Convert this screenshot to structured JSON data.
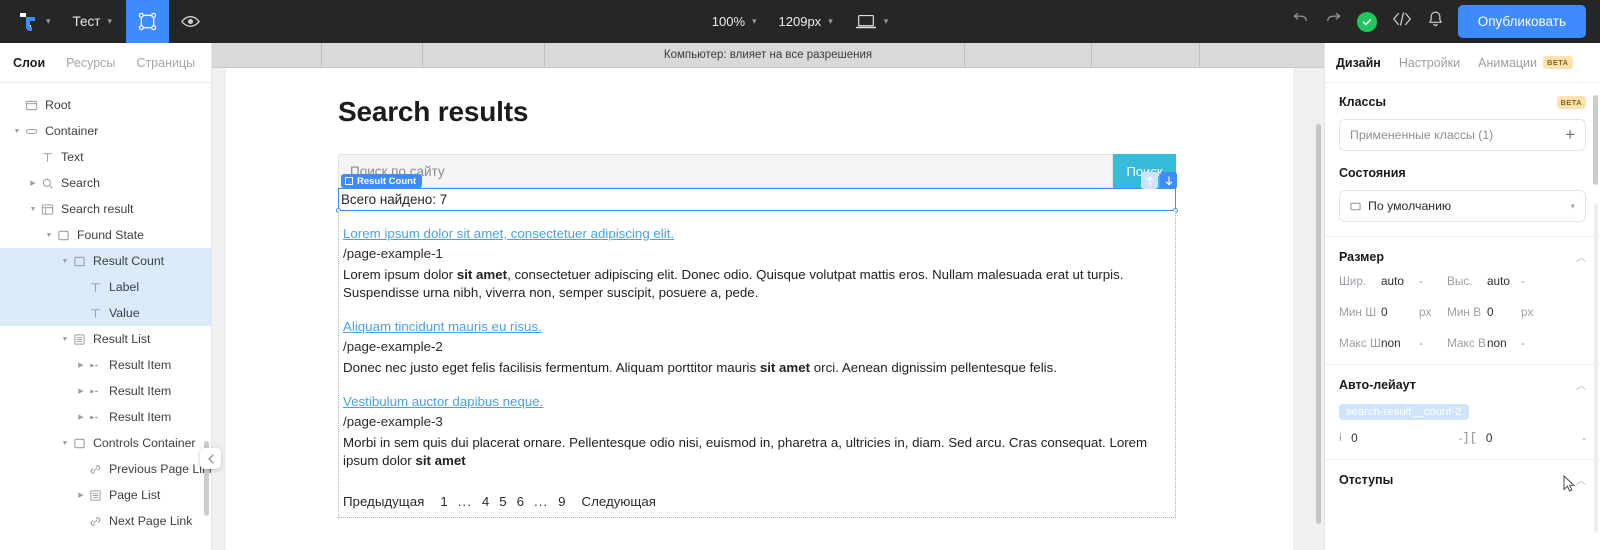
{
  "topbar": {
    "logo_icon": "taptop-logo-icon",
    "logo_caret_icon": "chevron-down-icon",
    "project_name": "Тест",
    "project_caret_icon": "chevron-down-icon",
    "select_tool_icon": "select-frame-icon",
    "preview_icon": "eye-icon",
    "zoom_value": "100%",
    "zoom_caret_icon": "chevron-down-icon",
    "width_value": "1209px",
    "width_caret_icon": "chevron-down-icon",
    "device_icon": "laptop-icon",
    "device_caret_icon": "chevron-down-icon",
    "undo_icon": "undo-arrow-icon",
    "redo_icon": "redo-arrow-icon",
    "saved_icon": "check-circle-icon",
    "code_icon": "code-brackets-icon",
    "bell_icon": "bell-icon",
    "publish_label": "Опубликовать",
    "accent_color": "#3d8bfd",
    "bg_color": "#262626",
    "success_color": "#22c55e"
  },
  "left_panel": {
    "tabs": [
      {
        "label": "Слои",
        "active": true
      },
      {
        "label": "Ресурсы",
        "active": false
      },
      {
        "label": "Страницы",
        "active": false
      }
    ],
    "add_icon": "plus-icon",
    "collapse_icon": "chevron-left-icon",
    "tree": [
      {
        "label": "Root",
        "depth": 0,
        "icon": "window-icon",
        "caret": "",
        "selected": false
      },
      {
        "label": "Container",
        "depth": 0,
        "icon": "container-icon",
        "caret": "down",
        "selected": false
      },
      {
        "label": "Text",
        "depth": 1,
        "icon": "text-icon",
        "caret": "",
        "selected": false
      },
      {
        "label": "Search",
        "depth": 1,
        "icon": "search-icon",
        "caret": "right",
        "selected": false
      },
      {
        "label": "Search result",
        "depth": 1,
        "icon": "list-icon",
        "caret": "down",
        "selected": false
      },
      {
        "label": "Found State",
        "depth": 2,
        "icon": "square-icon",
        "caret": "down",
        "selected": false
      },
      {
        "label": "Result Count",
        "depth": 3,
        "icon": "square-icon",
        "caret": "down",
        "selected": true
      },
      {
        "label": "Label",
        "depth": 4,
        "icon": "text-icon",
        "caret": "",
        "selected": true
      },
      {
        "label": "Value",
        "depth": 4,
        "icon": "text-icon",
        "caret": "",
        "selected": true
      },
      {
        "label": "Result List",
        "depth": 3,
        "icon": "listbox-icon",
        "caret": "down",
        "selected": false
      },
      {
        "label": "Result Item",
        "depth": 4,
        "icon": "item-icon",
        "caret": "right",
        "selected": false
      },
      {
        "label": "Result Item",
        "depth": 4,
        "icon": "item-icon",
        "caret": "right",
        "selected": false
      },
      {
        "label": "Result Item",
        "depth": 4,
        "icon": "item-icon",
        "caret": "right",
        "selected": false
      },
      {
        "label": "Controls Container",
        "depth": 3,
        "icon": "square-icon",
        "caret": "down",
        "selected": false
      },
      {
        "label": "Previous Page Link",
        "depth": 4,
        "icon": "link-icon",
        "caret": "",
        "selected": false
      },
      {
        "label": "Page List",
        "depth": 4,
        "icon": "listbox-icon",
        "caret": "right",
        "selected": false
      },
      {
        "label": "Next Page Link",
        "depth": 4,
        "icon": "link-icon",
        "caret": "",
        "selected": false
      }
    ]
  },
  "canvas": {
    "ruler_label": "Компьютер: влияет на все разрешения",
    "page": {
      "heading": "Search results",
      "search_placeholder": "Поиск по сайту",
      "search_button": "Поиск",
      "selection_badge": "Result Count",
      "selection_badge_icon": "square-icon",
      "move_up_icon": "arrow-up-icon",
      "move_down_icon": "arrow-down-icon",
      "count_text": "Всего найдено: 7",
      "results": [
        {
          "title": "Lorem ipsum dolor sit amet, consectetuer adipiscing elit.",
          "url": "/page-example-1",
          "desc_pre": "Lorem ipsum dolor ",
          "desc_bold": "sit amet",
          "desc_post": ", consectetuer adipiscing elit. Donec odio. Quisque volutpat mattis eros. Nullam malesuada erat ut turpis. Suspendisse urna nibh, viverra non, semper suscipit, posuere a, pede."
        },
        {
          "title": "Aliquam tincidunt mauris eu risus.",
          "url": "/page-example-2",
          "desc_pre": "Donec nec justo eget felis facilisis fermentum. Aliquam porttitor mauris ",
          "desc_bold": "sit amet",
          "desc_post": " orci. Aenean dignissim pellentesque felis."
        },
        {
          "title": "Vestibulum auctor dapibus neque.",
          "url": "/page-example-3",
          "desc_pre": "Morbi in sem quis dui placerat ornare. Pellentesque odio nisi, euismod in, pharetra a, ultricies in, diam. Sed arcu. Cras consequat. Lorem ipsum dolor ",
          "desc_bold": "sit amet",
          "desc_post": ""
        }
      ],
      "pagination": {
        "prev": "Предыдущая",
        "items": [
          "1",
          "...",
          "4",
          "5",
          "6",
          "...",
          "9"
        ],
        "next": "Следующая"
      }
    }
  },
  "right_panel": {
    "tabs": [
      {
        "label": "Дизайн",
        "active": true
      },
      {
        "label": "Настройки",
        "active": false
      },
      {
        "label": "Анимации",
        "active": false
      }
    ],
    "tabs_beta": "BETA",
    "classes": {
      "title": "Классы",
      "beta": "BETA",
      "field_placeholder": "Примененные классы (1)",
      "add_icon": "plus-icon"
    },
    "states": {
      "title": "Состояния",
      "value": "По умолчанию",
      "value_icon": "state-icon",
      "caret_icon": "chevron-down-icon"
    },
    "size": {
      "title": "Размер",
      "caret_icon": "chevron-up-icon",
      "rows": [
        {
          "l1": "Шир.",
          "v1": "auto",
          "u1": "-",
          "l2": "Выс.",
          "v2": "auto",
          "u2": "-"
        },
        {
          "l1": "Мин Ш",
          "v1": "0",
          "u1": "px",
          "l2": "Мин В",
          "v2": "0",
          "u2": "px"
        },
        {
          "l1": "Макс Ш",
          "v1": "non",
          "u1": "-",
          "l2": "Макс В",
          "v2": "non",
          "u2": "-"
        }
      ]
    },
    "autolayout": {
      "title": "Авто-лейаут",
      "caret_icon": "chevron-up-icon",
      "class_pill": "search-result__count-2",
      "gap_h_icon": "gap-horizontal-icon",
      "gap_h_value": "0",
      "gap_h_unit": "-",
      "gap_v_icon": "gap-vertical-icon",
      "gap_v_value": "0",
      "gap_v_unit": "-"
    },
    "spacing": {
      "title": "Отступы",
      "caret_icon": "chevron-up-icon"
    },
    "cursor_icon": "mouse-pointer-icon"
  }
}
